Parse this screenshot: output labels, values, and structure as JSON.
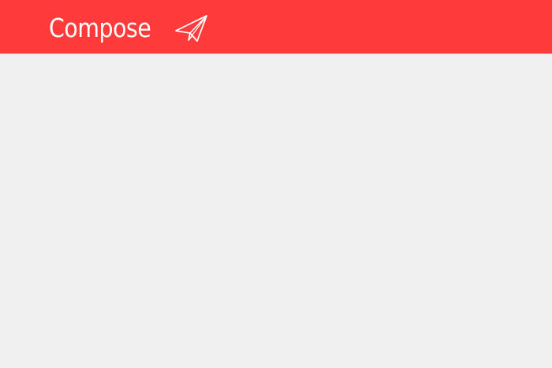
{
  "header": {
    "title": "Compose",
    "icon": "paper-plane-icon",
    "background_color": "#ff3a3a",
    "text_color": "#ffffff"
  },
  "main": {
    "background_color": "#f0f0f0"
  }
}
